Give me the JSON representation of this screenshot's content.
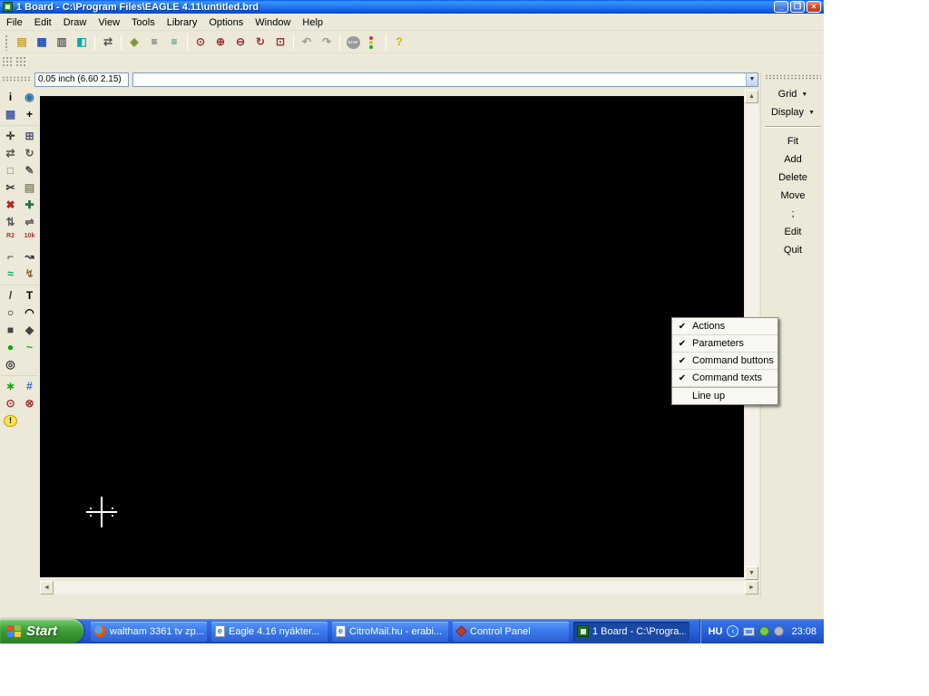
{
  "window": {
    "title": "1 Board - C:\\Program Files\\EAGLE 4.11\\untitled.brd",
    "controls": [
      "minimize",
      "restore",
      "close"
    ]
  },
  "menu_bar": {
    "items": [
      "File",
      "Edit",
      "Draw",
      "View",
      "Tools",
      "Library",
      "Options",
      "Window",
      "Help"
    ]
  },
  "toolbar": {
    "groups": [
      [
        "open",
        "save",
        "print",
        "cam-processor"
      ],
      [
        "switch-editor"
      ],
      [
        "use-library",
        "run-script",
        "run-ulp"
      ],
      [
        "zoom-fit",
        "zoom-in",
        "zoom-out",
        "zoom-redraw",
        "zoom-select"
      ],
      [
        "undo",
        "redo"
      ],
      [
        "stop",
        "traffic-light"
      ],
      [
        "help"
      ]
    ]
  },
  "command_bar": {
    "coordinates": "0.05 inch (6.60 2.15)",
    "command_value": ""
  },
  "left_palette": {
    "groups": [
      [
        "info",
        "show",
        "display",
        "mark"
      ],
      [
        "move",
        "copy",
        "mirror",
        "rotate",
        "group",
        "change",
        "cut",
        "paste",
        "delete",
        "add",
        "pinswap",
        "replace",
        "smash",
        "value",
        "miter",
        "split",
        "optimize",
        "ripup"
      ],
      [
        "wire",
        "text",
        "circle",
        "arc",
        "rect",
        "polygon",
        "via",
        "signal",
        "hole"
      ],
      [
        "ratsnest",
        "auto",
        "drc",
        "errors",
        "warning"
      ]
    ]
  },
  "right_panel": {
    "dropdowns": [
      {
        "label": "Grid"
      },
      {
        "label": "Display"
      }
    ],
    "buttons": [
      "Fit",
      "Add",
      "Delete",
      "Move",
      ";",
      "Edit",
      "Quit"
    ]
  },
  "context_menu": {
    "items": [
      {
        "label": "Actions",
        "checked": true
      },
      {
        "label": "Parameters",
        "checked": true
      },
      {
        "label": "Command buttons",
        "checked": true
      },
      {
        "label": "Command texts",
        "checked": true
      },
      {
        "label": "Line up",
        "checked": false,
        "separator_before": true
      }
    ]
  },
  "taskbar": {
    "start_label": "Start",
    "tasks": [
      {
        "label": "waltham 3361 tv zp...",
        "icon": "firefox",
        "active": false
      },
      {
        "label": "Eagle 4.16 nyákter...",
        "icon": "ie-document",
        "active": false
      },
      {
        "label": "CitroMail.hu - erabi...",
        "icon": "ie-document",
        "active": false
      },
      {
        "label": "Control Panel",
        "icon": "control-panel",
        "active": false
      },
      {
        "label": "1 Board - C:\\Progra...",
        "icon": "eagle",
        "active": true
      }
    ],
    "tray": {
      "language": "HU",
      "icons": [
        "hide-chevron",
        "network-display",
        "status-green",
        "messenger"
      ],
      "clock": "23:08"
    }
  },
  "colors": {
    "titlebar_blue": "#0A54E3",
    "taskbar_blue": "#2A62DC",
    "start_green": "#379531",
    "window_face": "#ECE9D8",
    "canvas_black": "#000000",
    "active_task_blue": "#1A49A5"
  }
}
